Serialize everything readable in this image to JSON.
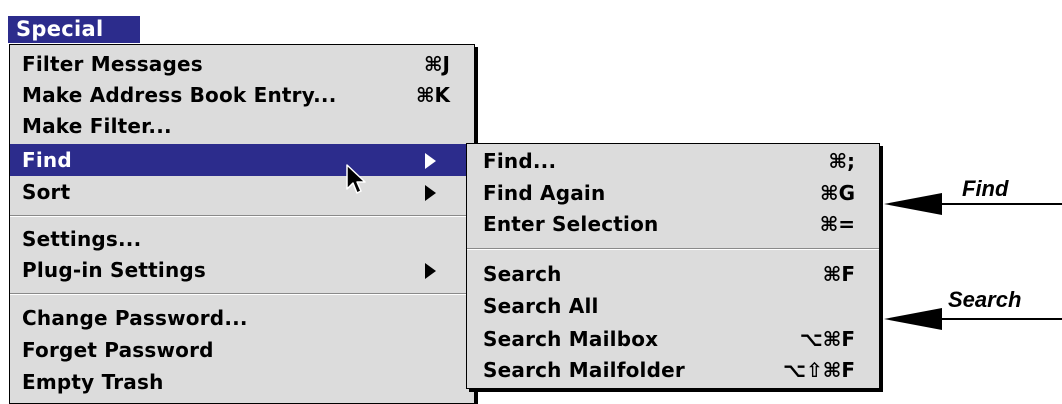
{
  "menu_title": "Special",
  "main_menu": {
    "items": [
      {
        "label": "Filter Messages",
        "shortcut": "⌘J"
      },
      {
        "label": "Make Address Book Entry...",
        "shortcut": "⌘K"
      },
      {
        "label": "Make Filter..."
      },
      {
        "label": "Find",
        "has_submenu": true,
        "highlighted": true
      },
      {
        "label": "Sort",
        "has_submenu": true
      },
      {
        "label": "Settings..."
      },
      {
        "label": "Plug-in Settings",
        "has_submenu": true
      },
      {
        "label": "Change Password..."
      },
      {
        "label": "Forget Password"
      },
      {
        "label": "Empty Trash"
      }
    ]
  },
  "find_submenu": {
    "items": [
      {
        "label": "Find...",
        "shortcut": "⌘;"
      },
      {
        "label": "Find Again",
        "shortcut": "⌘G"
      },
      {
        "label": "Enter Selection",
        "shortcut": "⌘="
      },
      {
        "label": "Search",
        "shortcut": "⌘F"
      },
      {
        "label": "Search All"
      },
      {
        "label": "Search Mailbox",
        "shortcut": "⌥⌘F"
      },
      {
        "label": "Search Mailfolder",
        "shortcut": "⌥⇧⌘F"
      }
    ]
  },
  "callouts": {
    "find": "Find",
    "search": "Search"
  },
  "colors": {
    "highlight": "#2c2c8c",
    "menu_bg": "#dcdcdc"
  }
}
